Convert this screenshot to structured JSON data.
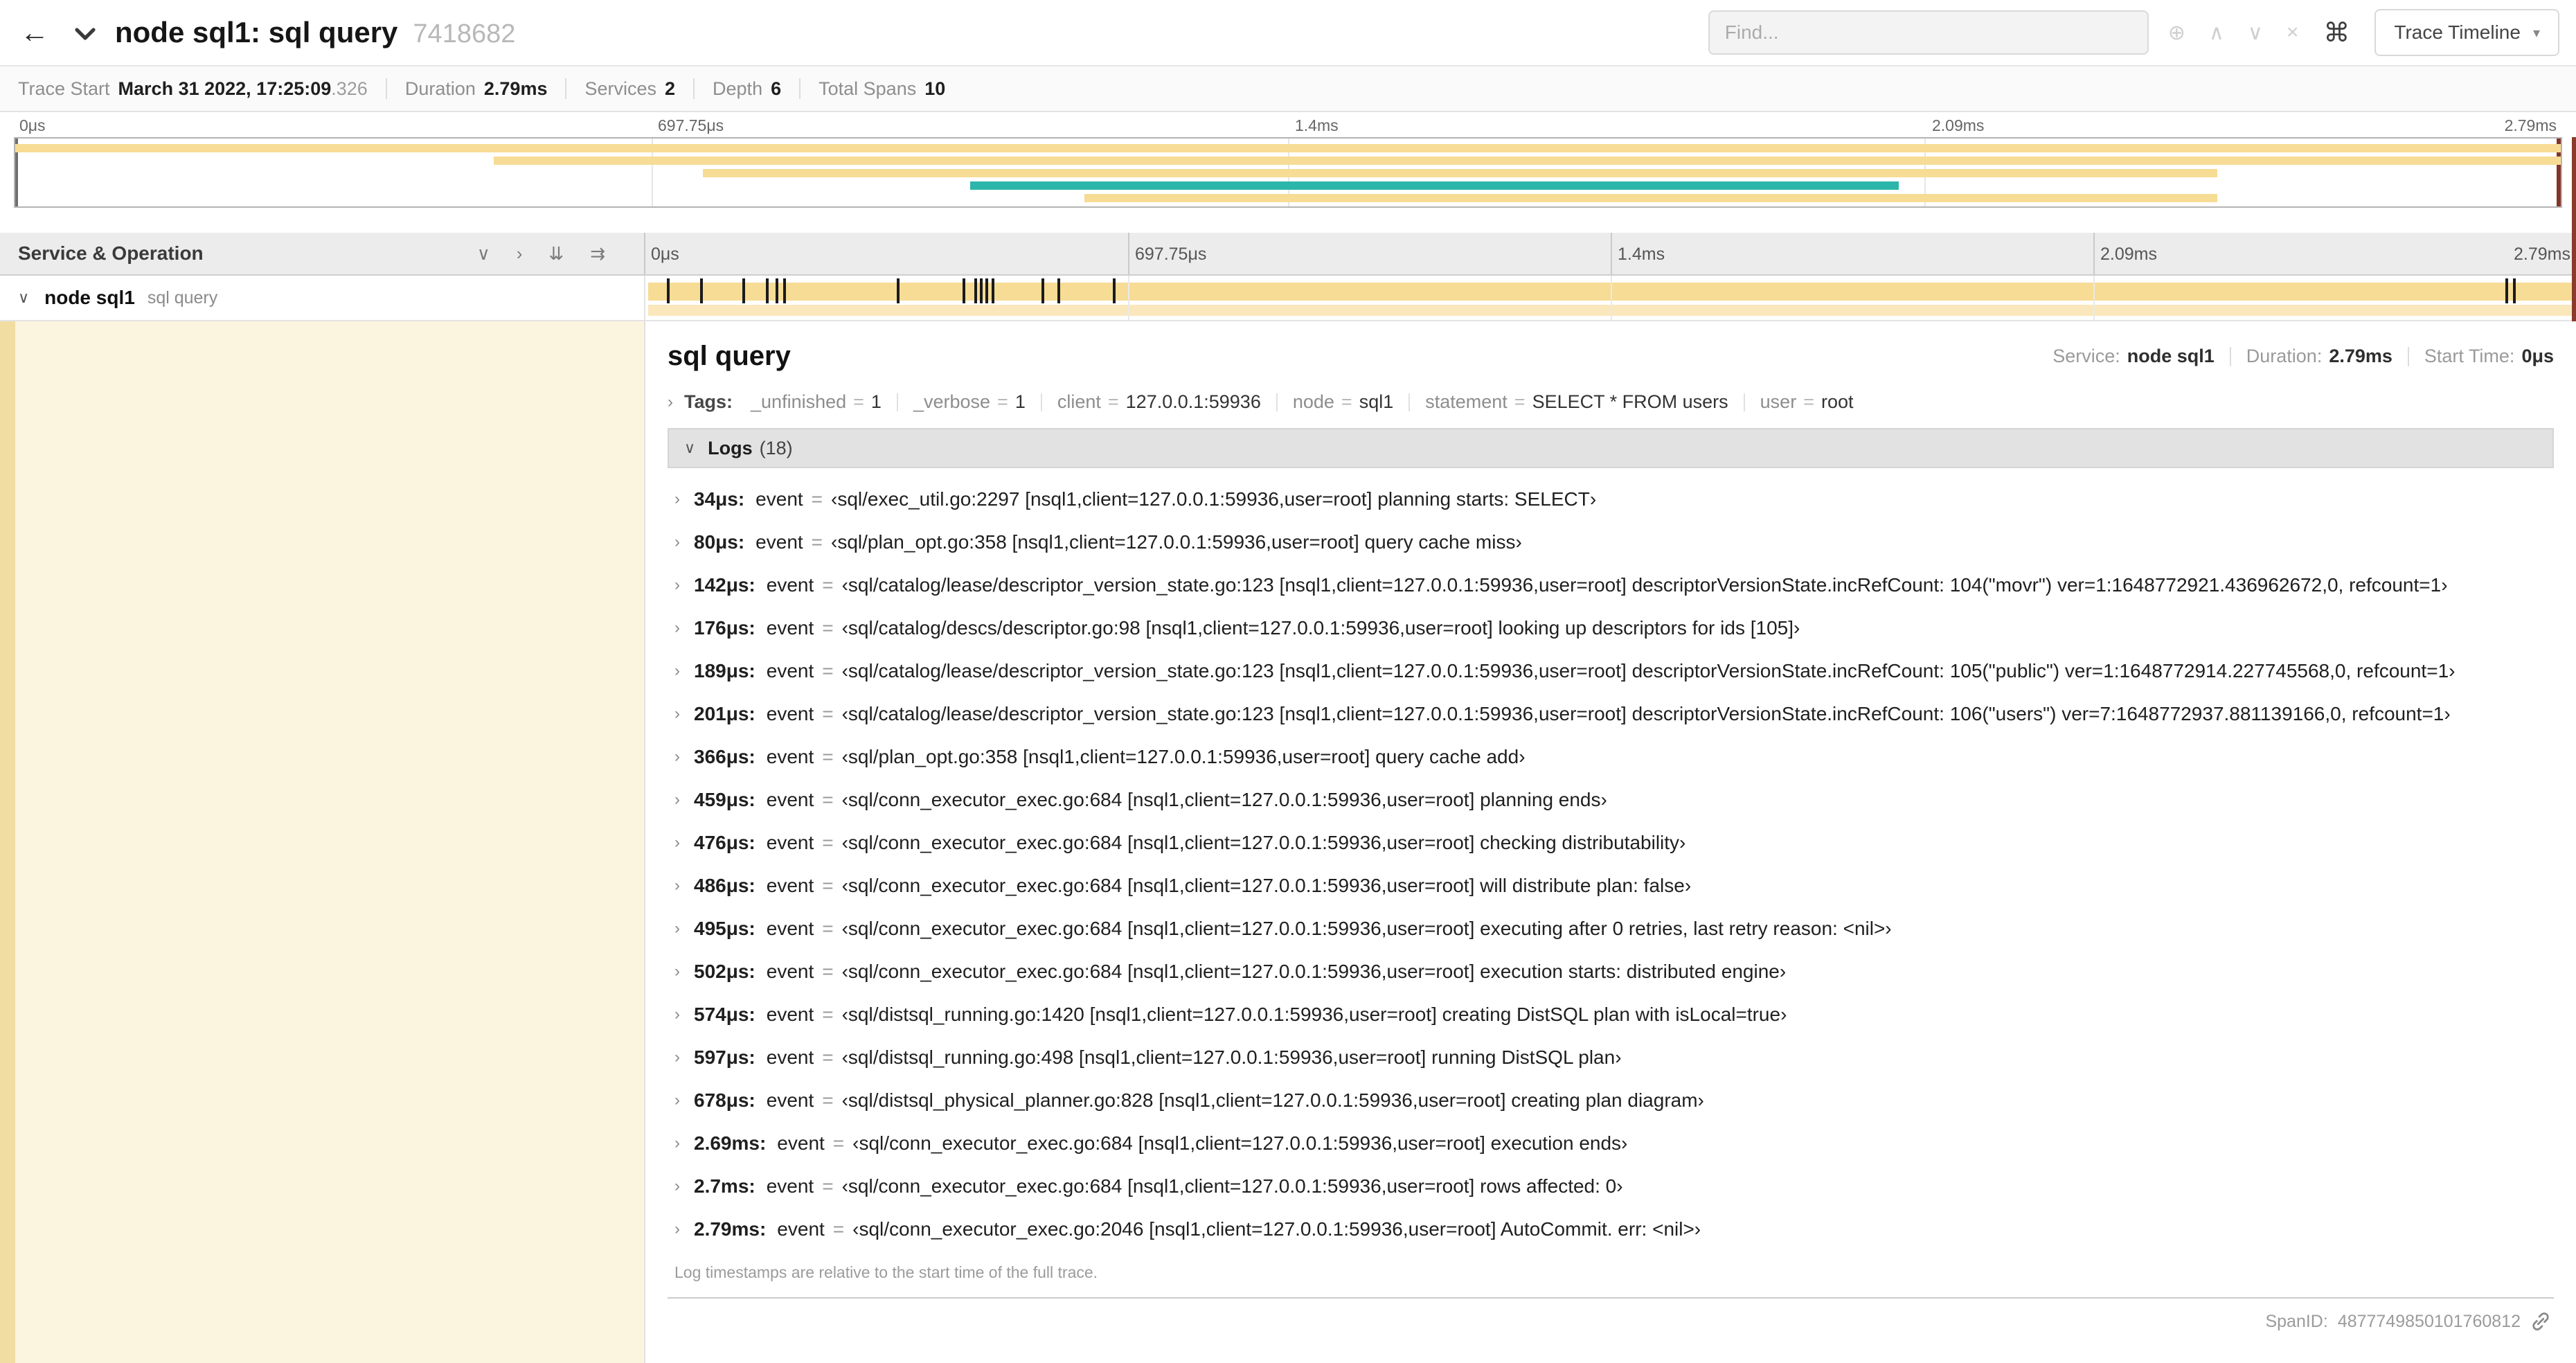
{
  "colors": {
    "span_tan": "#F7DC95",
    "span_tan_light": "#FAE8BC",
    "span_teal": "#2CB5AA",
    "detail_row_bg": "#FBF4DF",
    "accent_strip": "#F1DCA1"
  },
  "header": {
    "back_icon": "←",
    "title": "node sql1: sql query",
    "trace_id": "7418682",
    "find_placeholder": "Find...",
    "search_icons": [
      "⊕",
      "∧",
      "∨",
      "×"
    ],
    "shortcuts_icon": "⌘",
    "view_button": "Trace Timeline",
    "view_caret": "▾"
  },
  "summary": {
    "items": [
      {
        "label": "Trace Start",
        "value": "March 31 2022, 17:25:09",
        "suffix": ".326"
      },
      {
        "label": "Duration",
        "value": "2.79ms"
      },
      {
        "label": "Services",
        "value": "2"
      },
      {
        "label": "Depth",
        "value": "6"
      },
      {
        "label": "Total Spans",
        "value": "10"
      }
    ]
  },
  "minimap": {
    "ticks": [
      {
        "label": "0μs",
        "pct": 0
      },
      {
        "label": "697.75μs",
        "pct": 25
      },
      {
        "label": "1.4ms",
        "pct": 50
      },
      {
        "label": "2.09ms",
        "pct": 75
      },
      {
        "label": "2.79ms",
        "pct": 100
      }
    ],
    "bars": [
      {
        "start_pct": 0,
        "end_pct": 100,
        "color": "span_tan"
      },
      {
        "start_pct": 18.8,
        "end_pct": 100,
        "color": "span_tan"
      },
      {
        "start_pct": 27,
        "end_pct": 86.5,
        "color": "span_tan"
      },
      {
        "start_pct": 37.5,
        "end_pct": 74,
        "color": "span_teal"
      },
      {
        "start_pct": 42,
        "end_pct": 86.5,
        "color": "span_tan"
      }
    ]
  },
  "timeline": {
    "left_header": "Service & Operation",
    "header_icons": [
      "∨",
      "›",
      "⇊",
      "⇉"
    ],
    "ticks": [
      {
        "label": "0μs",
        "pct": 0
      },
      {
        "label": "697.75μs",
        "pct": 25
      },
      {
        "label": "1.4ms",
        "pct": 50
      },
      {
        "label": "2.09ms",
        "pct": 75
      },
      {
        "label": "2.79ms",
        "pct": 100
      }
    ],
    "row": {
      "collapse_icon": "∨",
      "service": "node sql1",
      "operation": "sql query"
    },
    "log_marker_pcts": [
      1.2,
      2.9,
      5.1,
      6.3,
      6.8,
      7.2,
      13.1,
      16.5,
      17.1,
      17.4,
      17.7,
      18.0,
      20.6,
      21.4,
      24.3,
      96.4,
      96.8,
      99.9
    ]
  },
  "detail": {
    "title": "sql query",
    "header_fields": [
      {
        "label": "Service:",
        "value": "node sql1"
      },
      {
        "label": "Duration:",
        "value": "2.79ms"
      },
      {
        "label": "Start Time:",
        "value": "0μs"
      }
    ],
    "tags_label": "Tags:",
    "tags": [
      {
        "key": "_unfinished",
        "value": "1"
      },
      {
        "key": "_verbose",
        "value": "1"
      },
      {
        "key": "client",
        "value": "127.0.0.1:59936"
      },
      {
        "key": "node",
        "value": "sql1"
      },
      {
        "key": "statement",
        "value": "SELECT * FROM users"
      },
      {
        "key": "user",
        "value": "root"
      }
    ],
    "logs_title": "Logs",
    "logs_count": "(18)",
    "logs": [
      {
        "time": "34μs:",
        "key": "event",
        "value": "‹sql/exec_util.go:2297 [nsql1,client=127.0.0.1:59936,user=root] planning starts: SELECT›"
      },
      {
        "time": "80μs:",
        "key": "event",
        "value": "‹sql/plan_opt.go:358 [nsql1,client=127.0.0.1:59936,user=root] query cache miss›"
      },
      {
        "time": "142μs:",
        "key": "event",
        "value": "‹sql/catalog/lease/descriptor_version_state.go:123 [nsql1,client=127.0.0.1:59936,user=root] descriptorVersionState.incRefCount: 104(\"movr\") ver=1:1648772921.436962672,0, refcount=1›"
      },
      {
        "time": "176μs:",
        "key": "event",
        "value": "‹sql/catalog/descs/descriptor.go:98 [nsql1,client=127.0.0.1:59936,user=root] looking up descriptors for ids [105]›"
      },
      {
        "time": "189μs:",
        "key": "event",
        "value": "‹sql/catalog/lease/descriptor_version_state.go:123 [nsql1,client=127.0.0.1:59936,user=root] descriptorVersionState.incRefCount: 105(\"public\") ver=1:1648772914.227745568,0, refcount=1›"
      },
      {
        "time": "201μs:",
        "key": "event",
        "value": "‹sql/catalog/lease/descriptor_version_state.go:123 [nsql1,client=127.0.0.1:59936,user=root] descriptorVersionState.incRefCount: 106(\"users\") ver=7:1648772937.881139166,0, refcount=1›"
      },
      {
        "time": "366μs:",
        "key": "event",
        "value": "‹sql/plan_opt.go:358 [nsql1,client=127.0.0.1:59936,user=root] query cache add›"
      },
      {
        "time": "459μs:",
        "key": "event",
        "value": "‹sql/conn_executor_exec.go:684 [nsql1,client=127.0.0.1:59936,user=root] planning ends›"
      },
      {
        "time": "476μs:",
        "key": "event",
        "value": "‹sql/conn_executor_exec.go:684 [nsql1,client=127.0.0.1:59936,user=root] checking distributability›"
      },
      {
        "time": "486μs:",
        "key": "event",
        "value": "‹sql/conn_executor_exec.go:684 [nsql1,client=127.0.0.1:59936,user=root] will distribute plan: false›"
      },
      {
        "time": "495μs:",
        "key": "event",
        "value": "‹sql/conn_executor_exec.go:684 [nsql1,client=127.0.0.1:59936,user=root] executing after 0 retries, last retry reason: <nil>›"
      },
      {
        "time": "502μs:",
        "key": "event",
        "value": "‹sql/conn_executor_exec.go:684 [nsql1,client=127.0.0.1:59936,user=root] execution starts: distributed engine›"
      },
      {
        "time": "574μs:",
        "key": "event",
        "value": "‹sql/distsql_running.go:1420 [nsql1,client=127.0.0.1:59936,user=root] creating DistSQL plan with isLocal=true›"
      },
      {
        "time": "597μs:",
        "key": "event",
        "value": "‹sql/distsql_running.go:498 [nsql1,client=127.0.0.1:59936,user=root] running DistSQL plan›"
      },
      {
        "time": "678μs:",
        "key": "event",
        "value": "‹sql/distsql_physical_planner.go:828 [nsql1,client=127.0.0.1:59936,user=root] creating plan diagram›"
      },
      {
        "time": "2.69ms:",
        "key": "event",
        "value": "‹sql/conn_executor_exec.go:684 [nsql1,client=127.0.0.1:59936,user=root] execution ends›"
      },
      {
        "time": "2.7ms:",
        "key": "event",
        "value": "‹sql/conn_executor_exec.go:684 [nsql1,client=127.0.0.1:59936,user=root] rows affected: 0›"
      },
      {
        "time": "2.79ms:",
        "key": "event",
        "value": "‹sql/conn_executor_exec.go:2046 [nsql1,client=127.0.0.1:59936,user=root] AutoCommit. err: <nil>›"
      }
    ],
    "logs_note": "Log timestamps are relative to the start time of the full trace.",
    "span_id_label": "SpanID:",
    "span_id_value": "4877749850101760812"
  }
}
